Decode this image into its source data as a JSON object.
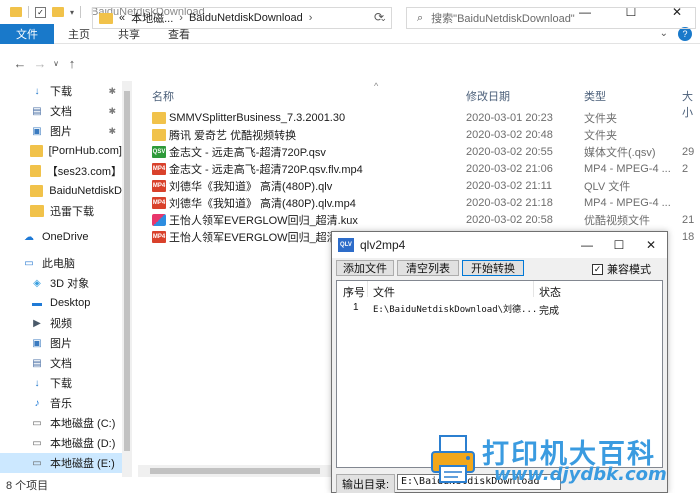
{
  "window": {
    "title": "BaiduNetdiskDownload",
    "controls": {
      "minimize": "—",
      "maximize": "☐",
      "close": "✕"
    }
  },
  "ribbon": {
    "tabs": [
      "文件",
      "主页",
      "共享",
      "查看"
    ],
    "collapse": "⌄",
    "help": "?"
  },
  "address": {
    "path_prefix": "«",
    "path_parts": [
      "本地磁...",
      "BaiduNetdiskDownload"
    ],
    "separator": "›",
    "dropdown": "⌄",
    "refresh": "⟳"
  },
  "search": {
    "placeholder": "搜索\"BaiduNetdiskDownload\""
  },
  "nav": {
    "items": [
      {
        "label": "下载",
        "icon": "download-arrow-icon",
        "pinned": true
      },
      {
        "label": "文档",
        "icon": "document-icon",
        "pinned": true
      },
      {
        "label": "图片",
        "icon": "pictures-icon",
        "pinned": true
      },
      {
        "label": "[PornHub.com]",
        "icon": "folder-icon",
        "pinned": false
      },
      {
        "label": "【ses23.com】",
        "icon": "folder-icon",
        "pinned": false
      },
      {
        "label": "BaiduNetdiskD",
        "icon": "folder-icon",
        "pinned": false
      },
      {
        "label": "迅雷下载",
        "icon": "folder-icon",
        "pinned": false
      },
      {
        "label": "OneDrive",
        "icon": "cloud-icon",
        "pinned": false
      },
      {
        "label": "此电脑",
        "icon": "computer-icon",
        "pinned": false
      },
      {
        "label": "3D 对象",
        "icon": "cube-icon",
        "pinned": false
      },
      {
        "label": "Desktop",
        "icon": "desktop-icon",
        "pinned": false
      },
      {
        "label": "视频",
        "icon": "video-icon",
        "pinned": false
      },
      {
        "label": "图片",
        "icon": "pictures-icon",
        "pinned": false
      },
      {
        "label": "文档",
        "icon": "document-icon",
        "pinned": false
      },
      {
        "label": "下载",
        "icon": "download-arrow-icon",
        "pinned": false
      },
      {
        "label": "音乐",
        "icon": "music-icon",
        "pinned": false
      },
      {
        "label": "本地磁盘 (C:)",
        "icon": "drive-icon",
        "pinned": false
      },
      {
        "label": "本地磁盘 (D:)",
        "icon": "drive-icon",
        "pinned": false
      },
      {
        "label": "本地磁盘 (E:)",
        "icon": "drive-icon",
        "pinned": false,
        "selected": true
      }
    ],
    "pin_glyph": "📌"
  },
  "columns": {
    "name": "名称",
    "date": "修改日期",
    "type": "类型",
    "size": "大小",
    "sort_glyph": "^"
  },
  "files": [
    {
      "name": "SMMVSplitterBusiness_7.3.2001.30",
      "date": "2020-03-01 20:23",
      "type": "文件夹",
      "size": "",
      "icon": "folder-icon"
    },
    {
      "name": "腾讯 爱奇艺 优酷视频转换",
      "date": "2020-03-02 20:48",
      "type": "文件夹",
      "size": "",
      "icon": "folder-icon"
    },
    {
      "name": "金志文 - 远走高飞-超清720P.qsv",
      "date": "2020-03-02 20:55",
      "type": "媒体文件(.qsv)",
      "size": "29",
      "icon": "qsv-file-icon"
    },
    {
      "name": "金志文 - 远走高飞-超清720P.qsv.flv.mp4",
      "date": "2020-03-02 21:06",
      "type": "MP4 - MPEG-4 ...",
      "size": "2",
      "icon": "mp4-file-icon"
    },
    {
      "name": "刘德华《我知道》 高清(480P).qlv",
      "date": "2020-03-02 21:11",
      "type": "QLV 文件",
      "size": "",
      "icon": "mp4-file-icon"
    },
    {
      "name": "刘德华《我知道》 高清(480P).qlv.mp4",
      "date": "2020-03-02 21:18",
      "type": "MP4 - MPEG-4 ...",
      "size": "",
      "icon": "mp4-file-icon"
    },
    {
      "name": "王怡人领军EVERGLOW回归_超清.kux",
      "date": "2020-03-02 20:58",
      "type": "优酷视频文件",
      "size": "21",
      "icon": "kux-file-icon"
    },
    {
      "name": "王怡人领军EVERGLOW回归_超清.mp",
      "date": "",
      "type": "",
      "size": "18",
      "icon": "mp4-file-icon"
    }
  ],
  "file_icon_text": {
    "qsv": "QSV",
    "mp4": "MP4"
  },
  "status": {
    "item_count": "8 个项目"
  },
  "dialog": {
    "title": "qlv2mp4",
    "logo_text": "QLV",
    "controls": {
      "minimize": "—",
      "maximize": "☐",
      "close": "✕"
    },
    "buttons": {
      "add_file": "添加文件",
      "clear_list": "清空列表",
      "start_convert": "开始转换"
    },
    "compat_mode": {
      "label": "兼容模式",
      "checked": true,
      "check_glyph": "✓"
    },
    "list_headers": {
      "index": "序号",
      "file": "文件",
      "status": "状态"
    },
    "rows": [
      {
        "index": "1",
        "file": "E:\\BaiduNetdiskDownload\\刘德...",
        "status": "完成"
      }
    ],
    "output_label": "输出目录:",
    "output_path": "E:\\BaiduNetdiskDownload"
  },
  "watermark": {
    "line1": "打印机大百科",
    "line2": "www.djydbk.com"
  }
}
